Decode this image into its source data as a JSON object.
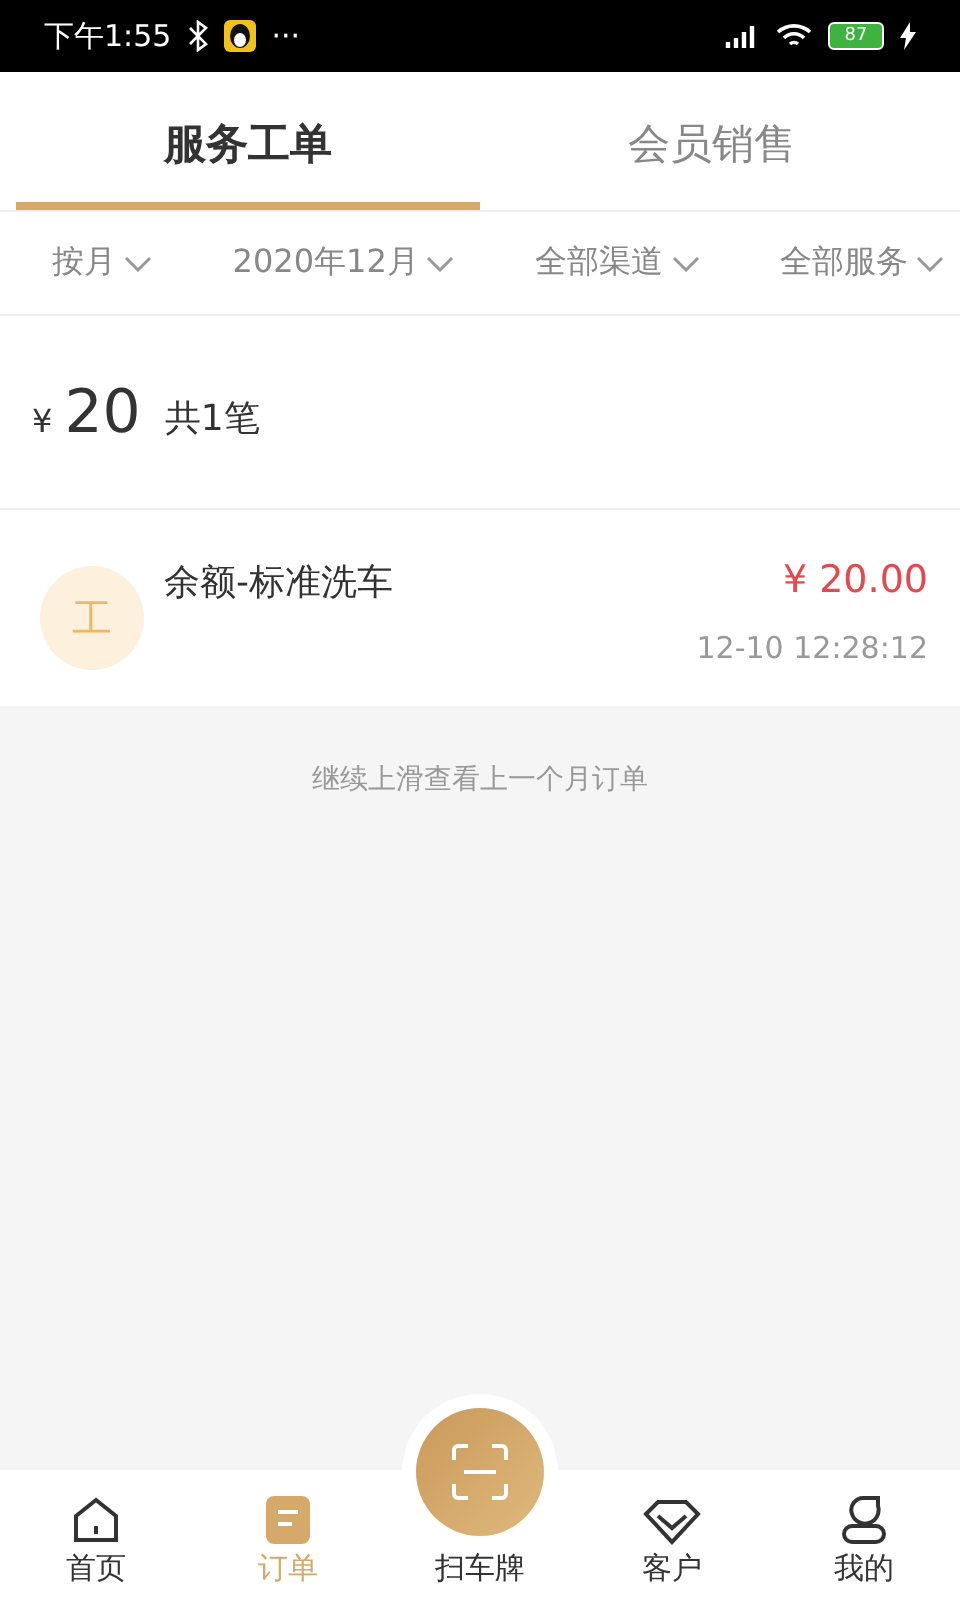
{
  "status_bar": {
    "time": "下午1:55",
    "more": "···",
    "battery": "87"
  },
  "tabs": [
    {
      "label": "服务工单",
      "selected": true
    },
    {
      "label": "会员销售",
      "selected": false
    }
  ],
  "filters": [
    {
      "label": "按月"
    },
    {
      "label": "2020年12月"
    },
    {
      "label": "全部渠道"
    },
    {
      "label": "全部服务"
    }
  ],
  "summary": {
    "currency": "¥",
    "amount": "20",
    "count": "共1笔"
  },
  "orders": [
    {
      "avatar": "工",
      "title": "余额-标准洗车",
      "price": "¥ 20.00",
      "time": "12-10 12:28:12"
    }
  ],
  "hint": "继续上滑查看上一个月订单",
  "nav": [
    {
      "kind": "home",
      "label": "首页",
      "selected": false
    },
    {
      "kind": "orders",
      "label": "订单",
      "selected": true
    },
    {
      "kind": "scan",
      "label": "扫车牌",
      "selected": false
    },
    {
      "kind": "customer",
      "label": "客户",
      "selected": false
    },
    {
      "kind": "me",
      "label": "我的",
      "selected": false
    }
  ]
}
